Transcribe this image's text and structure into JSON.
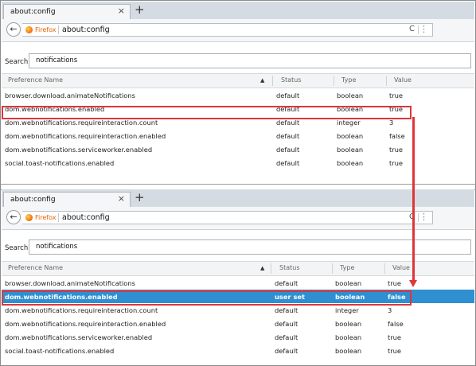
{
  "colors": {
    "highlight": "#e0353a",
    "selected_row": "#2f8fd0",
    "firefox": "#e66000",
    "tabstrip": "#d4dbe3"
  },
  "icons": {
    "back": "back-arrow-icon",
    "firefox": "firefox-logo-icon",
    "reload": "reload-icon",
    "more": "dots-more-icon"
  },
  "top": {
    "tab": {
      "title": "about:config",
      "close": "×"
    },
    "newtab": "+",
    "nav": {
      "back": "←",
      "identity": "Firefox",
      "url": "about:config",
      "reload": "C",
      "more": "⋮"
    },
    "search": {
      "label": "Search:",
      "value": "notifications"
    },
    "columns": [
      "Preference Name",
      "Status",
      "Type",
      "Value"
    ],
    "sort_icon": "▲",
    "rows": [
      {
        "name": "browser.download.animateNotifications",
        "status": "default",
        "type": "boolean",
        "value": "true"
      },
      {
        "name": "dom.webnotifications.enabled",
        "status": "default",
        "type": "boolean",
        "value": "true"
      },
      {
        "name": "dom.webnotifications.requireinteraction.count",
        "status": "default",
        "type": "integer",
        "value": "3"
      },
      {
        "name": "dom.webnotifications.requireinteraction.enabled",
        "status": "default",
        "type": "boolean",
        "value": "false"
      },
      {
        "name": "dom.webnotifications.serviceworker.enabled",
        "status": "default",
        "type": "boolean",
        "value": "true"
      },
      {
        "name": "social.toast-notifications.enabled",
        "status": "default",
        "type": "boolean",
        "value": "true"
      }
    ]
  },
  "bottom": {
    "tab": {
      "title": "about:config",
      "close": "×"
    },
    "newtab": "+",
    "nav": {
      "back": "←",
      "identity": "Firefox",
      "url": "about:config",
      "reload": "C",
      "more": "⋮"
    },
    "search": {
      "label": "Search:",
      "value": "notifications"
    },
    "columns": [
      "Preference Name",
      "Status",
      "Type",
      "Value"
    ],
    "sort_icon": "▲",
    "rows": [
      {
        "name": "browser.download.animateNotifications",
        "status": "default",
        "type": "boolean",
        "value": "true"
      },
      {
        "name": "dom.webnotifications.enabled",
        "status": "user set",
        "type": "boolean",
        "value": "false"
      },
      {
        "name": "dom.webnotifications.requireinteraction.count",
        "status": "default",
        "type": "integer",
        "value": "3"
      },
      {
        "name": "dom.webnotifications.requireinteraction.enabled",
        "status": "default",
        "type": "boolean",
        "value": "false"
      },
      {
        "name": "dom.webnotifications.serviceworker.enabled",
        "status": "default",
        "type": "boolean",
        "value": "true"
      },
      {
        "name": "social.toast-notifications.enabled",
        "status": "default",
        "type": "boolean",
        "value": "true"
      }
    ]
  }
}
